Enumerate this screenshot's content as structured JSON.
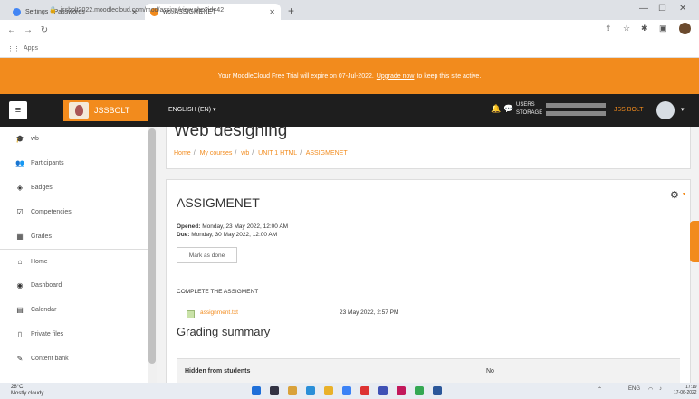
{
  "browser": {
    "tabs": [
      {
        "title": "Settings - Passwords",
        "active": false
      },
      {
        "title": "wb: ASSIGMENET",
        "active": true
      }
    ],
    "url": "jssbolt2022.moodlecloud.com/mod/assign/view.php?id=42",
    "bookmarks_label": "Apps"
  },
  "banner": {
    "prefix": "Your MoodleCloud Free Trial will expire on 07-Jul-2022.",
    "link": "Upgrade now",
    "suffix": "to keep this site active."
  },
  "navbar": {
    "site_name": "JSSBOLT",
    "language": "ENGLISH (EN) ▾",
    "usage_users": "USERS",
    "usage_storage": "STORAGE",
    "user_name": "JSS BOLT"
  },
  "drawer": {
    "items": [
      {
        "label": "wb",
        "icon": "graduation-cap-icon"
      },
      {
        "label": "Participants",
        "icon": "users-icon"
      },
      {
        "label": "Badges",
        "icon": "badge-icon"
      },
      {
        "label": "Competencies",
        "icon": "checkbox-icon"
      },
      {
        "label": "Grades",
        "icon": "table-icon"
      },
      {
        "label": "Home",
        "icon": "home-icon"
      },
      {
        "label": "Dashboard",
        "icon": "dashboard-icon"
      },
      {
        "label": "Calendar",
        "icon": "calendar-icon"
      },
      {
        "label": "Private files",
        "icon": "file-icon"
      },
      {
        "label": "Content bank",
        "icon": "pen-icon"
      }
    ]
  },
  "page": {
    "title": "Web designing",
    "breadcrumbs": [
      "Home",
      "My courses",
      "wb",
      "UNIT 1 HTML",
      "ASSIGMENET"
    ],
    "assignment_title": "ASSIGMENET",
    "opened_label": "Opened:",
    "opened_value": "Monday, 23 May 2022, 12:00 AM",
    "due_label": "Due:",
    "due_value": "Monday, 30 May 2022, 12:00 AM",
    "mark_done": "Mark as done",
    "intro": "COMPLETE THE ASSIGMENT",
    "file_name": "assignment.txt",
    "file_date": "23 May 2022, 2:57 PM",
    "grading_title": "Grading summary",
    "grading_rows": [
      {
        "label": "Hidden from students",
        "value": "No"
      }
    ]
  },
  "taskbar": {
    "temp": "28°C",
    "weather": "Mostly cloudy",
    "lang": "ENG",
    "time": "17:19",
    "date": "17-06-2022"
  }
}
